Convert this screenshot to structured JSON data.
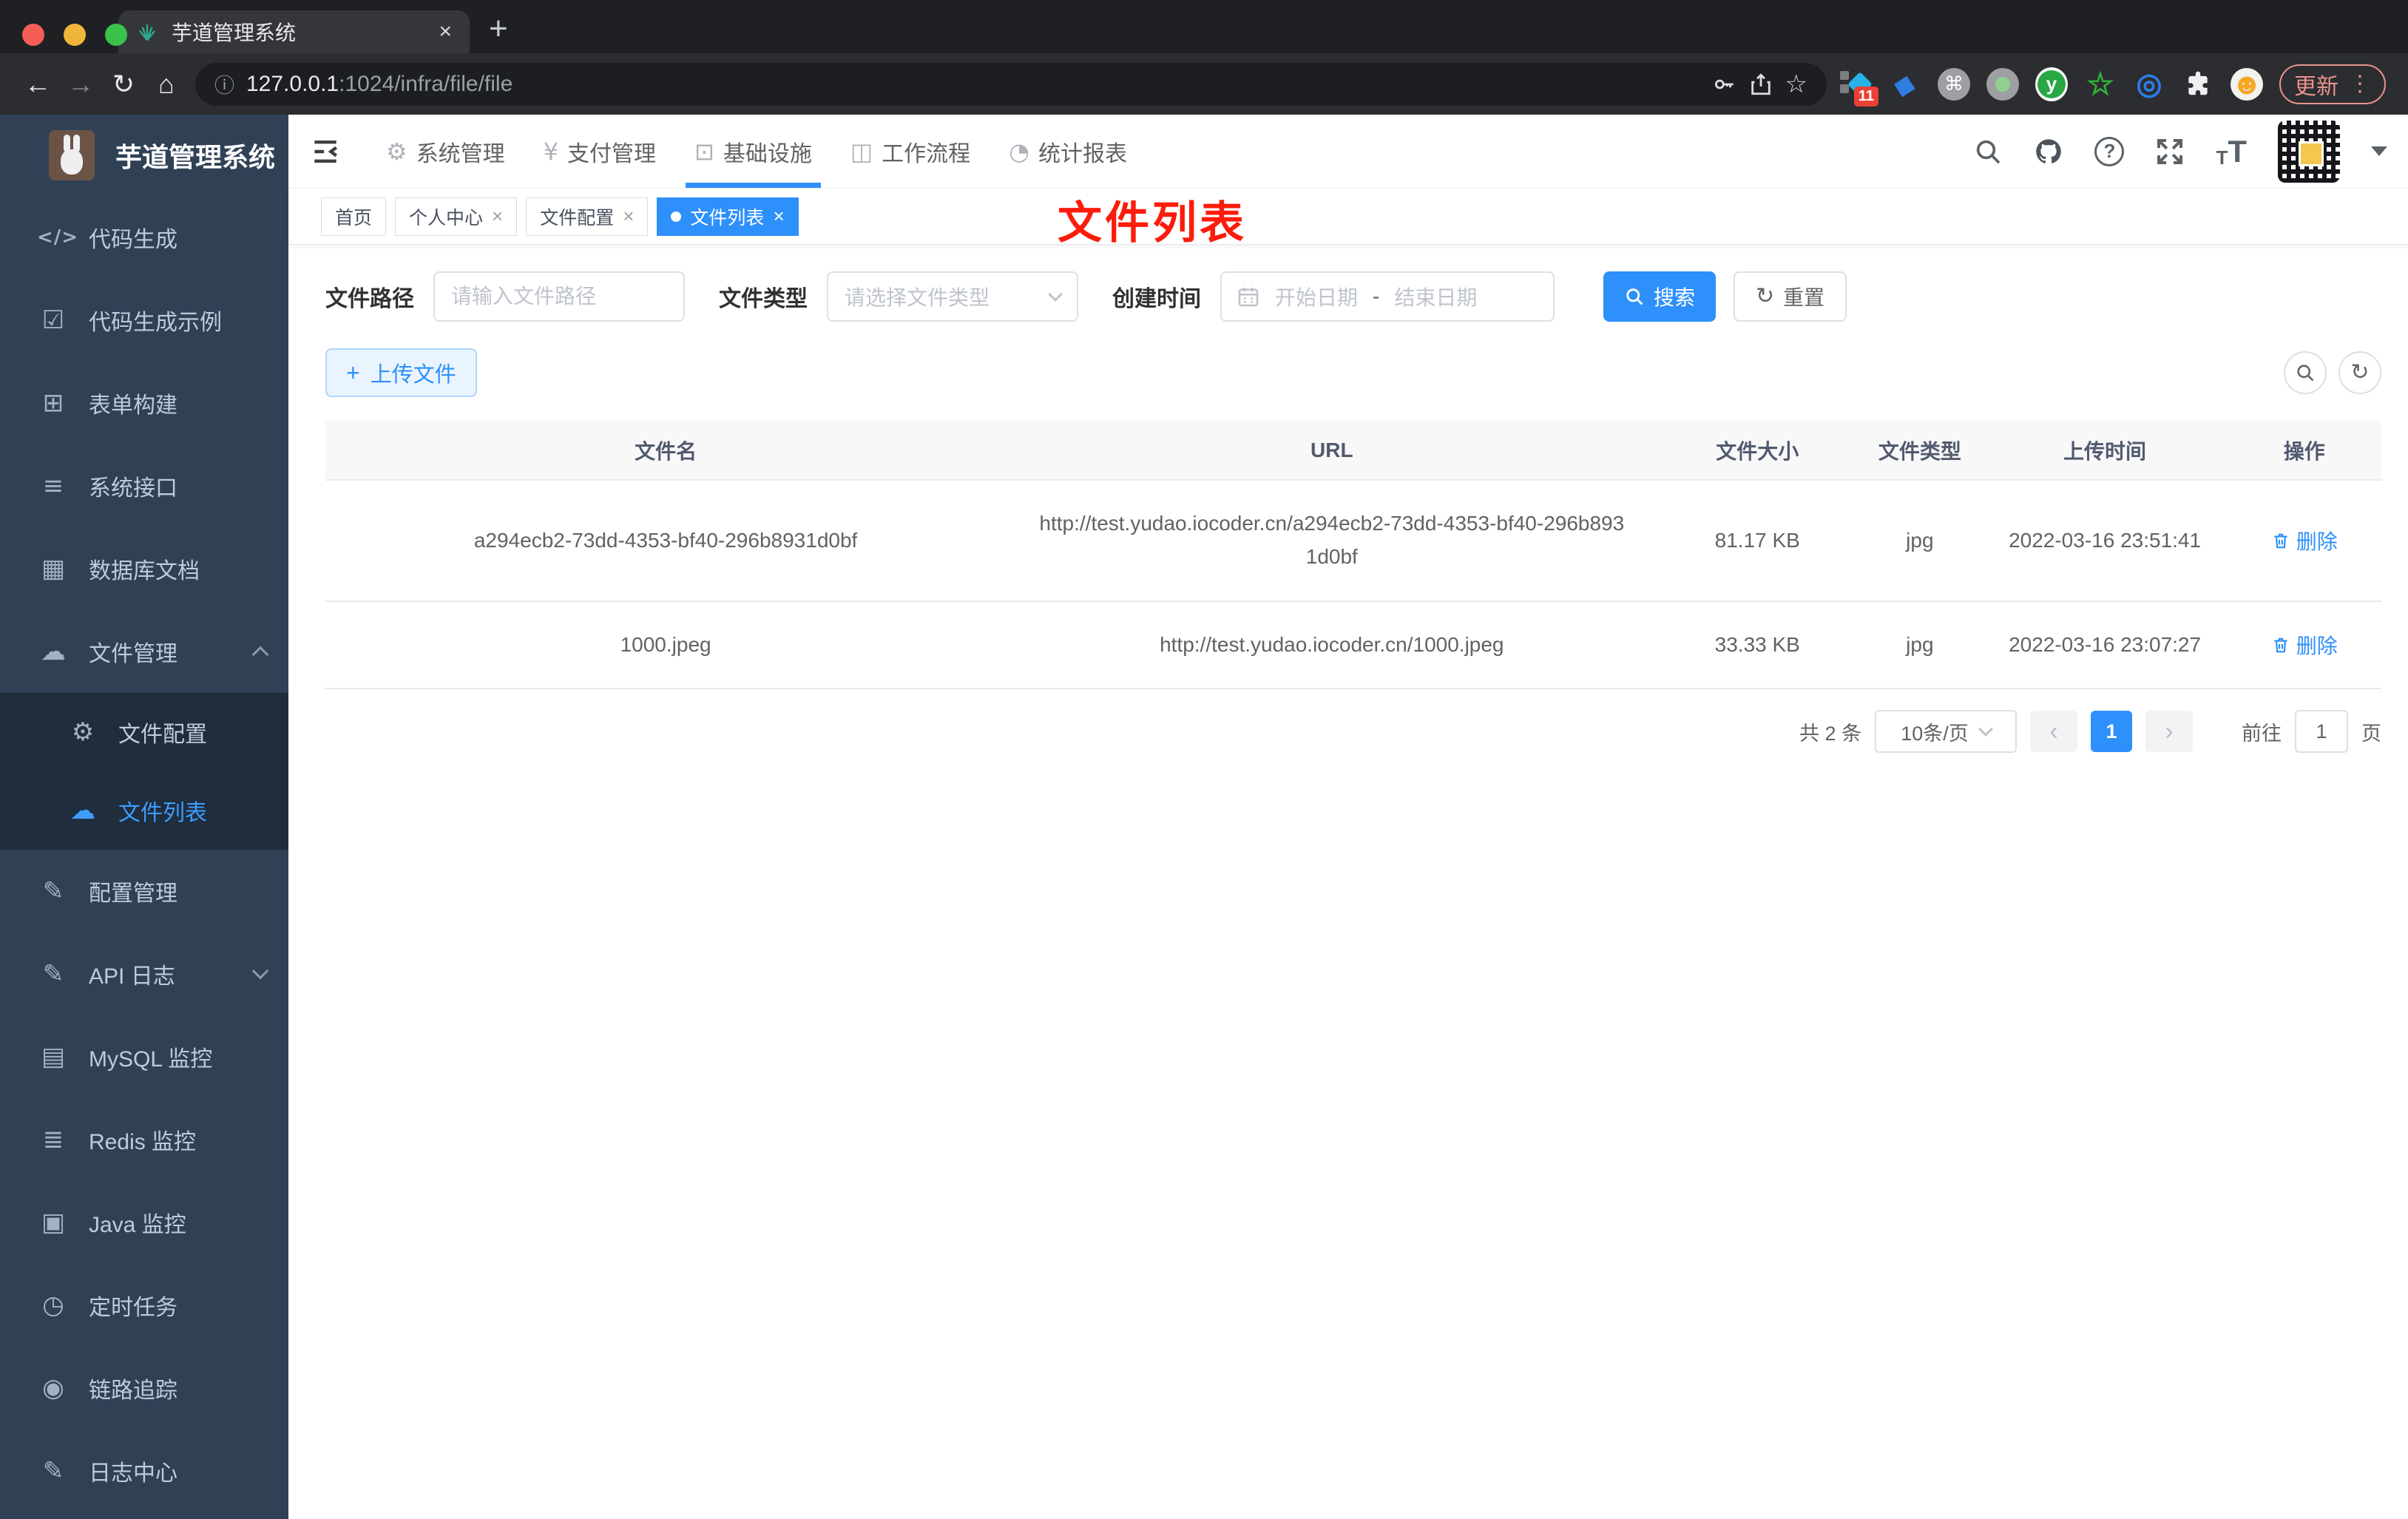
{
  "browser": {
    "tab_title": "芋道管理系统",
    "url_host": "127.0.0.1",
    "url_path": ":1024/infra/file/file",
    "extensions_badge": "11",
    "update_label": "更新"
  },
  "glyphs": {
    "back": "←",
    "forward": "→",
    "reload": "↻",
    "home": "⌂",
    "info": "ⓘ",
    "star": "☆",
    "plus": "+",
    "close": "×",
    "dots": "⋮",
    "cmd": "⌘",
    "kite": "◆",
    "green_star": "☆",
    "eye_ext": "◎",
    "smiley": "☻",
    "y_letter": "y",
    "help": "?",
    "t_small": "T",
    "t_large": "T",
    "code": "</>",
    "shield": "☑",
    "form": "⊞",
    "sliders": "≡",
    "db": "▦",
    "cloud": "☁",
    "gear": "⚙",
    "edit": "✎",
    "board": "▤",
    "layers": "≣",
    "monitor": "▣",
    "timer": "◷",
    "eye": "◉",
    "yen": "¥",
    "monitor_check": "⊡",
    "briefcase": "◫",
    "gauge": "◔",
    "refresh": "↻",
    "prev": "‹",
    "next": "›"
  },
  "logo": {
    "title": "芋道管理系统"
  },
  "topnav": {
    "items": [
      {
        "label": "系统管理"
      },
      {
        "label": "支付管理"
      },
      {
        "label": "基础设施",
        "active": true
      },
      {
        "label": "工作流程"
      },
      {
        "label": "统计报表"
      }
    ]
  },
  "sidebar": {
    "items": [
      {
        "label": "代码生成",
        "icon": "code-icon"
      },
      {
        "label": "代码生成示例",
        "icon": "shield-check-icon"
      },
      {
        "label": "表单构建",
        "icon": "form-builder-icon"
      },
      {
        "label": "系统接口",
        "icon": "sliders-icon"
      },
      {
        "label": "数据库文档",
        "icon": "database-icon"
      },
      {
        "label": "文件管理",
        "icon": "cloud-download-icon",
        "expanded": true,
        "children": [
          {
            "label": "文件配置",
            "icon": "gear-icon"
          },
          {
            "label": "文件列表",
            "icon": "cloud-upload-icon",
            "active": true
          }
        ]
      },
      {
        "label": "配置管理",
        "icon": "edit-square-icon"
      },
      {
        "label": "API 日志",
        "icon": "log-edit-icon",
        "collapsible": true
      },
      {
        "label": "MySQL 监控",
        "icon": "chart-board-icon"
      },
      {
        "label": "Redis 监控",
        "icon": "layers-icon"
      },
      {
        "label": "Java 监控",
        "icon": "monitor-icon"
      },
      {
        "label": "定时任务",
        "icon": "timer-icon"
      },
      {
        "label": "链路追踪",
        "icon": "eye-icon"
      },
      {
        "label": "日志中心",
        "icon": "log-center-icon"
      }
    ]
  },
  "tags": {
    "items": [
      {
        "label": "首页",
        "closable": false,
        "active": false
      },
      {
        "label": "个人中心",
        "closable": true,
        "active": false
      },
      {
        "label": "文件配置",
        "closable": true,
        "active": false
      },
      {
        "label": "文件列表",
        "closable": true,
        "active": true
      }
    ]
  },
  "annotation": "文件列表",
  "filter": {
    "path_label": "文件路径",
    "path_placeholder": "请输入文件路径",
    "type_label": "文件类型",
    "type_placeholder": "请选择文件类型",
    "date_label": "创建时间",
    "date_start_placeholder": "开始日期",
    "date_separator": "-",
    "date_end_placeholder": "结束日期",
    "search_label": "搜索",
    "reset_label": "重置"
  },
  "toolbar": {
    "upload_label": "上传文件"
  },
  "table": {
    "columns": [
      "文件名",
      "URL",
      "文件大小",
      "文件类型",
      "上传时间",
      "操作"
    ],
    "rows": [
      {
        "name": "a294ecb2-73dd-4353-bf40-296b8931d0bf",
        "url": "http://test.yudao.iocoder.cn/a294ecb2-73dd-4353-bf40-296b8931d0bf",
        "size": "81.17 KB",
        "type": "jpg",
        "time": "2022-03-16 23:51:41",
        "action": "删除"
      },
      {
        "name": "1000.jpeg",
        "url": "http://test.yudao.iocoder.cn/1000.jpeg",
        "size": "33.33 KB",
        "type": "jpg",
        "time": "2022-03-16 23:07:27",
        "action": "删除"
      }
    ]
  },
  "pagination": {
    "total": "共 2 条",
    "page_size": "10条/页",
    "current": "1",
    "goto_label": "前往",
    "goto_value": "1",
    "unit_label": "页"
  },
  "colors": {
    "accent": "#2e90fa",
    "sidebar_bg": "#304156",
    "submenu_bg": "#1f2d3d",
    "annotation_red": "#fb1c0c",
    "badge_red": "#e94235",
    "table_header_bg": "#f8f8f9"
  }
}
